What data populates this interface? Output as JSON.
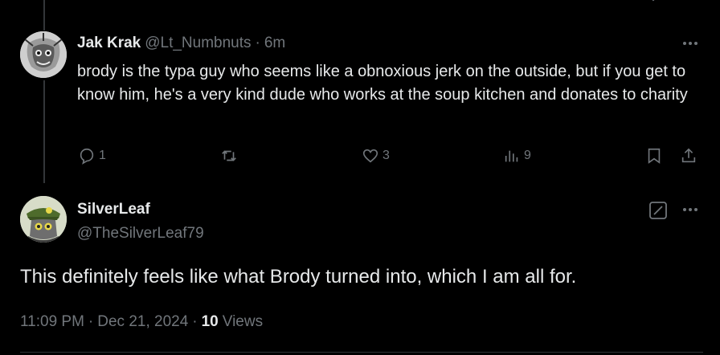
{
  "reply": {
    "author_name": "Jak Krak",
    "handle": "@Lt_Numbnuts",
    "separator": "·",
    "time": "6m",
    "text": "brody is the typa guy who seems like a obnoxious jerk on the outside, but if you get to know him, he's a very kind dude who works at the soup kitchen and donates to charity",
    "actions": {
      "reply_count": "1",
      "repost_count": "",
      "like_count": "3",
      "views_count": "9"
    }
  },
  "main": {
    "author_name": "SilverLeaf",
    "handle": "@TheSilverLeaf79",
    "text": "This definitely feels like what Brody turned into, which I am all for.",
    "time": "11:09 PM",
    "separator_1": "·",
    "date": "Dec 21, 2024",
    "separator_2": "·",
    "views_count": "10",
    "views_label": "Views"
  },
  "colors": {
    "background": "#000000",
    "text_primary": "#e7e9ea",
    "text_muted": "#71767b",
    "divider": "#2f3336"
  },
  "icons": [
    "reply-icon",
    "repost-icon",
    "like-icon",
    "views-icon",
    "bookmark-icon",
    "share-icon",
    "more-icon",
    "edit-icon"
  ]
}
